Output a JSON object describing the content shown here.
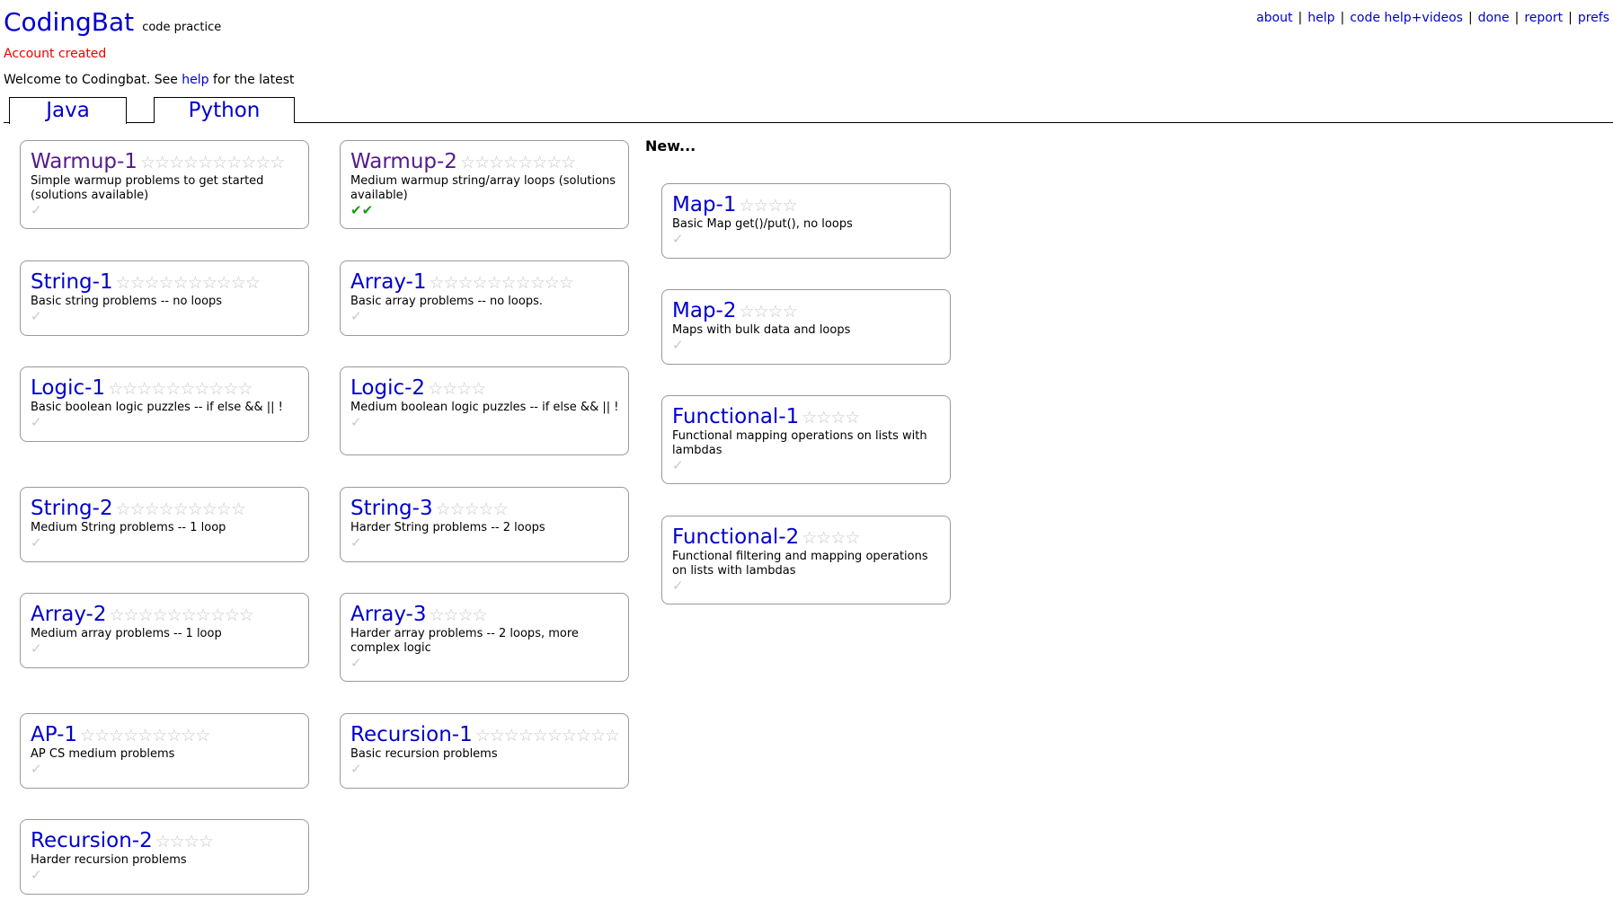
{
  "header": {
    "logo": "CodingBat",
    "tagline": "code practice",
    "status": "Account created",
    "welcome_prefix": "Welcome to Codingbat. See",
    "welcome_link": "help",
    "welcome_suffix": "for the latest"
  },
  "toplinks": [
    "about",
    "help",
    "code help+videos",
    "done",
    "report",
    "prefs"
  ],
  "tabs": [
    {
      "label": "Java",
      "active": true
    },
    {
      "label": "Python",
      "active": false
    }
  ],
  "new_header": "New...",
  "cards": [
    {
      "title": "Warmup-1",
      "stars": "☆☆☆☆☆☆☆☆☆☆",
      "desc": "Simple warmup problems to get started (solutions available)",
      "check": "✓",
      "visited": true
    },
    {
      "title": "Warmup-2",
      "stars": "☆☆☆☆☆☆☆☆",
      "desc": "Medium warmup string/array loops (solutions available)",
      "check": "✔✔",
      "visited": true,
      "done": true
    },
    {
      "title": "String-1",
      "stars": "☆☆☆☆☆☆☆☆☆☆",
      "desc": "Basic string problems -- no loops",
      "check": "✓"
    },
    {
      "title": "Array-1",
      "stars": "☆☆☆☆☆☆☆☆☆☆",
      "desc": "Basic array problems -- no loops.",
      "check": "✓"
    },
    {
      "title": "Logic-1",
      "stars": "☆☆☆☆☆☆☆☆☆☆",
      "desc": "Basic boolean logic puzzles -- if else && || !",
      "check": "✓"
    },
    {
      "title": "Logic-2",
      "stars": "☆☆☆☆",
      "desc": "Medium boolean logic puzzles -- if else && || !",
      "check": "✓"
    },
    {
      "title": "String-2",
      "stars": "☆☆☆☆☆☆☆☆☆",
      "desc": "Medium String problems -- 1 loop",
      "check": "✓"
    },
    {
      "title": "String-3",
      "stars": "☆☆☆☆☆",
      "desc": "Harder String problems -- 2 loops",
      "check": "✓"
    },
    {
      "title": "Array-2",
      "stars": "☆☆☆☆☆☆☆☆☆☆",
      "desc": "Medium array problems -- 1 loop",
      "check": "✓"
    },
    {
      "title": "Array-3",
      "stars": "☆☆☆☆",
      "desc": "Harder array problems -- 2 loops, more complex logic",
      "check": "✓"
    },
    {
      "title": "AP-1",
      "stars": "☆☆☆☆☆☆☆☆☆",
      "desc": "AP CS medium problems",
      "check": "✓"
    },
    {
      "title": "Recursion-1",
      "stars": "☆☆☆☆☆☆☆☆☆☆",
      "desc": "Basic recursion problems",
      "check": "✓"
    },
    {
      "title": "Recursion-2",
      "stars": "☆☆☆☆",
      "desc": "Harder recursion problems",
      "check": "✓"
    },
    {
      "title": "Map-1",
      "stars": "☆☆☆☆",
      "desc": "Basic Map get()/put(), no loops",
      "check": "✓"
    },
    {
      "title": "Map-2",
      "stars": "☆☆☆☆",
      "desc": "Maps with bulk data and loops",
      "check": "✓"
    },
    {
      "title": "Functional-1",
      "stars": "☆☆☆☆",
      "desc": "Functional mapping operations on lists with lambdas",
      "check": "✓"
    },
    {
      "title": "Functional-2",
      "stars": "☆☆☆☆",
      "desc": "Functional filtering and mapping operations on lists with lambdas",
      "check": "✓"
    }
  ]
}
